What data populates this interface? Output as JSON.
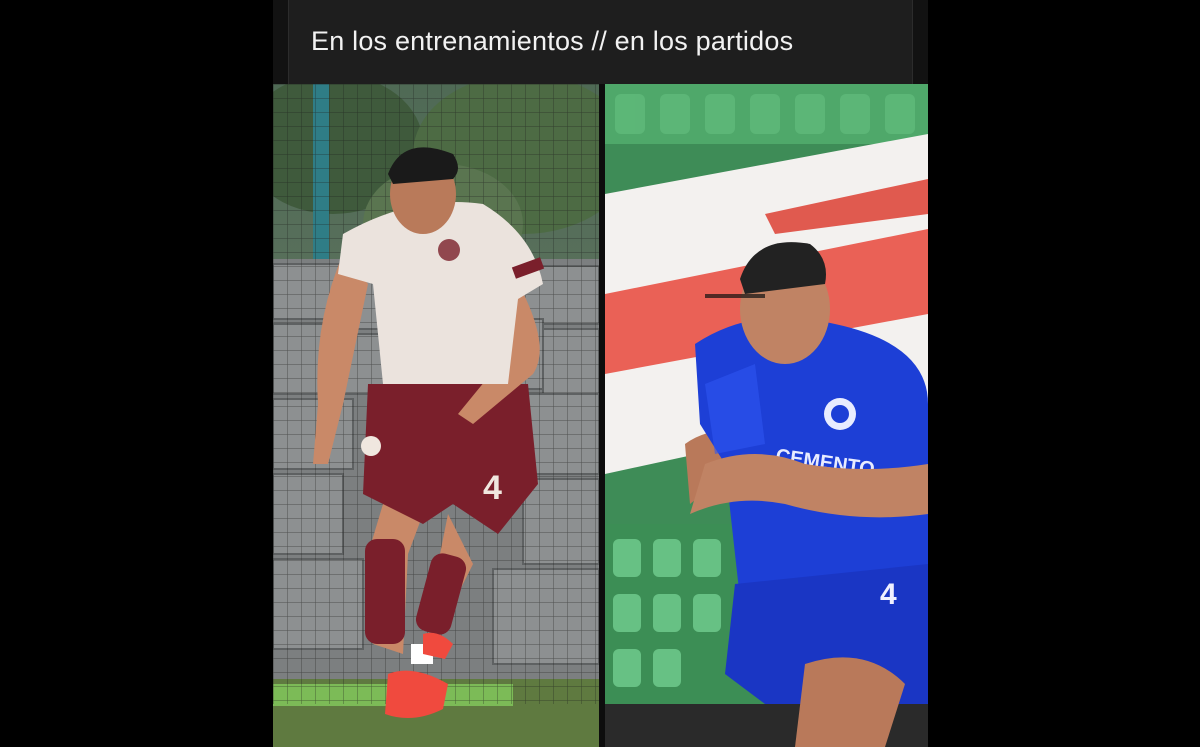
{
  "post": {
    "caption": "En los entrenamientos // en los partidos"
  },
  "images": {
    "left": {
      "description_icon": "training-photo",
      "jersey_number": "4"
    },
    "right": {
      "description_icon": "match-photo",
      "jersey_number": "4",
      "jersey_sponsor": "CEMENTO"
    }
  },
  "colors": {
    "background": "#000000",
    "caption_bar": "#1e1e1e",
    "caption_text": "#f2f2f2",
    "training_shorts": "#7a1f2b",
    "match_kit": "#1d3fd6"
  }
}
